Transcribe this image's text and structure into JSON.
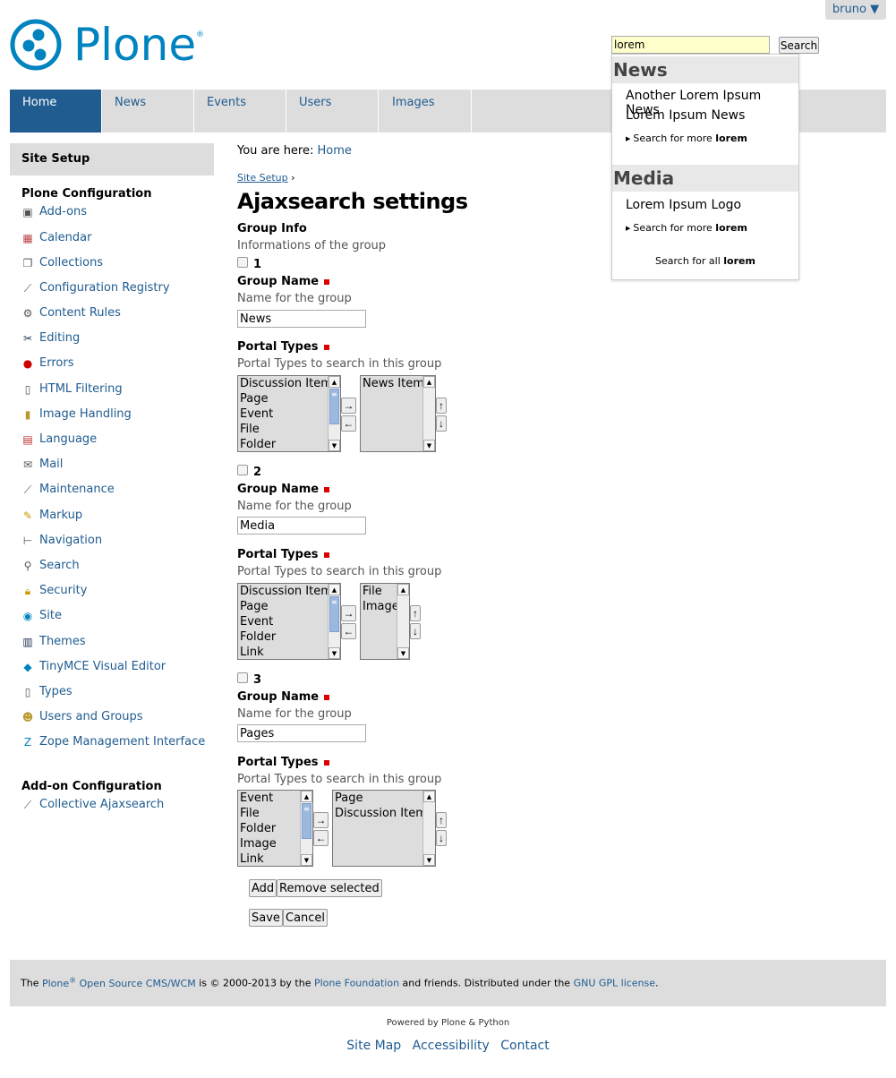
{
  "user": {
    "name": "bruno",
    "caret": "▼"
  },
  "logo": {
    "text": "Plone",
    "reg": "®"
  },
  "search": {
    "value": "lorem",
    "button": "Search"
  },
  "nav": {
    "tabs": [
      {
        "label": "Home",
        "active": true
      },
      {
        "label": "News"
      },
      {
        "label": "Events"
      },
      {
        "label": "Users"
      },
      {
        "label": "Images"
      }
    ]
  },
  "livesearch": {
    "groups": [
      {
        "title": "News",
        "items": [
          "Another Lorem Ipsum News",
          "Lorem Ipsum News"
        ],
        "more_prefix": "Search for more",
        "term": "lorem"
      },
      {
        "title": "Media",
        "items": [
          "Lorem Ipsum Logo"
        ],
        "more_prefix": "Search for more",
        "term": "lorem"
      }
    ],
    "all_prefix": "Search for all",
    "all_term": "lorem"
  },
  "sidebar": {
    "title": "Site Setup",
    "plone_config": "Plone Configuration",
    "items": [
      {
        "label": "Add-ons",
        "icon": "addons-icon"
      },
      {
        "label": "Calendar",
        "icon": "calendar-icon"
      },
      {
        "label": "Collections",
        "icon": "collections-icon"
      },
      {
        "label": "Configuration Registry",
        "icon": "wrench-icon"
      },
      {
        "label": "Content Rules",
        "icon": "content-rules-icon"
      },
      {
        "label": "Editing",
        "icon": "scissors-icon"
      },
      {
        "label": "Errors",
        "icon": "error-icon"
      },
      {
        "label": "HTML Filtering",
        "icon": "document-icon"
      },
      {
        "label": "Image Handling",
        "icon": "image-icon"
      },
      {
        "label": "Language",
        "icon": "flag-icon"
      },
      {
        "label": "Mail",
        "icon": "mail-icon"
      },
      {
        "label": "Maintenance",
        "icon": "wrench-icon"
      },
      {
        "label": "Markup",
        "icon": "pencil-icon"
      },
      {
        "label": "Navigation",
        "icon": "navigation-icon"
      },
      {
        "label": "Search",
        "icon": "search-icon"
      },
      {
        "label": "Security",
        "icon": "lock-icon"
      },
      {
        "label": "Site",
        "icon": "plone-icon"
      },
      {
        "label": "Themes",
        "icon": "themes-icon"
      },
      {
        "label": "TinyMCE Visual Editor",
        "icon": "tinymce-icon"
      },
      {
        "label": "Types",
        "icon": "document-icon"
      },
      {
        "label": "Users and Groups",
        "icon": "users-icon"
      },
      {
        "label": "Zope Management Interface",
        "icon": "zope-icon"
      }
    ],
    "addon_config": "Add-on Configuration",
    "addon_items": [
      {
        "label": "Collective Ajaxsearch",
        "icon": "wrench-icon"
      }
    ]
  },
  "breadcrumbs": {
    "prefix": "You are here:",
    "home": "Home"
  },
  "parent_link": "Site Setup",
  "parent_sep": "›",
  "page_title": "Ajaxsearch settings",
  "group_info": {
    "label": "Group Info",
    "help": "Informations of the group"
  },
  "field_labels": {
    "group_name": "Group Name",
    "group_name_help": "Name for the group",
    "portal_types": "Portal Types",
    "portal_types_help": "Portal Types to search in this group"
  },
  "groups": [
    {
      "num": "1",
      "name": "News",
      "available": [
        "Discussion Item",
        "Page",
        "Event",
        "File",
        "Folder"
      ],
      "selected": [
        "News Item"
      ]
    },
    {
      "num": "2",
      "name": "Media",
      "available": [
        "Discussion Item",
        "Page",
        "Event",
        "Folder",
        "Link"
      ],
      "selected": [
        "File",
        "Image"
      ]
    },
    {
      "num": "3",
      "name": "Pages",
      "available": [
        "Event",
        "File",
        "Folder",
        "Image",
        "Link"
      ],
      "selected": [
        "Page",
        "Discussion Item"
      ]
    }
  ],
  "buttons": {
    "add": "Add",
    "remove": "Remove selected",
    "save": "Save",
    "cancel": "Cancel"
  },
  "arrows": {
    "right": "→",
    "left": "←",
    "up": "↑",
    "down": "↓"
  },
  "footer": {
    "the": "The",
    "plone": "Plone",
    "reg": "®",
    "cms": "Open Source CMS/WCM",
    "mid": "is © 2000-2013 by the",
    "foundation": "Plone Foundation",
    "friends": "and friends. Distributed under the",
    "license": "GNU GPL license",
    "dot": "."
  },
  "powered": "Powered by Plone & Python",
  "site_actions": [
    "Site Map",
    "Accessibility",
    "Contact"
  ],
  "colors": {
    "nav_active": "#205c90",
    "link": "#205c90",
    "logo": "#0083be",
    "required": "#dd0000"
  }
}
